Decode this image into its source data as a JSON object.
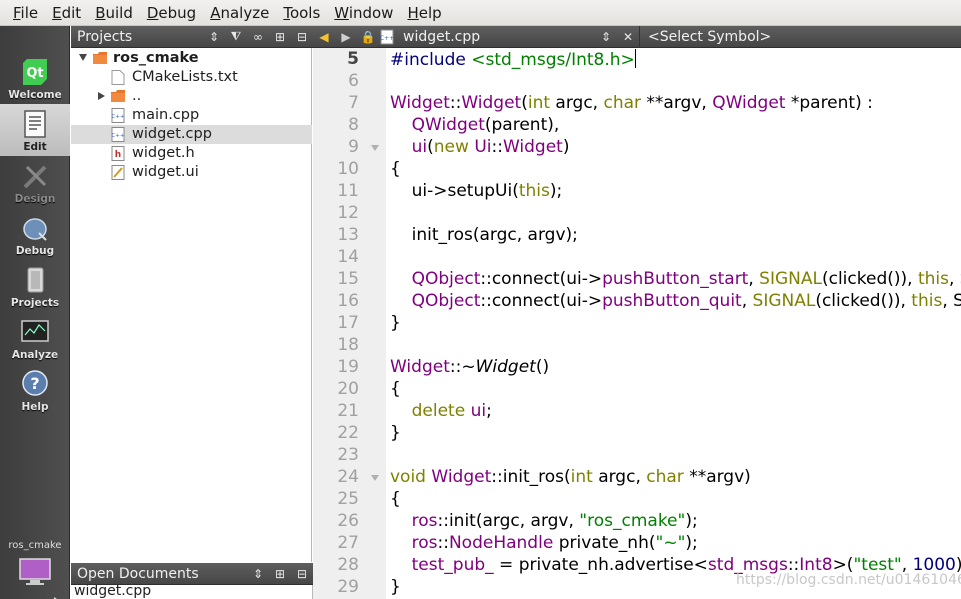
{
  "menu": [
    {
      "u": "F",
      "rest": "ile"
    },
    {
      "u": "E",
      "rest": "dit"
    },
    {
      "u": "B",
      "rest": "uild"
    },
    {
      "u": "D",
      "rest": "ebug"
    },
    {
      "u": "A",
      "rest": "nalyze"
    },
    {
      "u": "T",
      "rest": "ools"
    },
    {
      "u": "W",
      "rest": "indow"
    },
    {
      "u": "H",
      "rest": "elp"
    }
  ],
  "modes": [
    {
      "label": "Welcome",
      "icon": "qt-logo-icon"
    },
    {
      "label": "Edit",
      "icon": "edit-document-icon"
    },
    {
      "label": "Design",
      "icon": "design-pencil-icon"
    },
    {
      "label": "Debug",
      "icon": "debug-bug-icon"
    },
    {
      "label": "Projects",
      "icon": "projects-wrench-icon"
    },
    {
      "label": "Analyze",
      "icon": "analyze-monitor-icon"
    },
    {
      "label": "Help",
      "icon": "help-question-icon"
    }
  ],
  "kit": {
    "label": "ros_cmake",
    "small": "all"
  },
  "projects_panel": {
    "title": "Projects"
  },
  "open_docs_panel": {
    "title": "Open Documents",
    "first_doc": "widget.cpp"
  },
  "editor": {
    "file_tab": "widget.cpp",
    "symbol": "<Select Symbol>"
  },
  "tree": [
    {
      "label": "ros_cmake",
      "type": "project"
    },
    {
      "label": "CMakeLists.txt",
      "type": "file"
    },
    {
      "label": "..",
      "type": "folder"
    },
    {
      "label": "main.cpp",
      "type": "cpp"
    },
    {
      "label": "widget.cpp",
      "type": "cpp",
      "selected": true
    },
    {
      "label": "widget.h",
      "type": "header"
    },
    {
      "label": "widget.ui",
      "type": "ui"
    }
  ],
  "line_numbers": [
    "5",
    "6",
    "7",
    "8",
    "9",
    "10",
    "11",
    "12",
    "13",
    "14",
    "15",
    "16",
    "17",
    "18",
    "19",
    "20",
    "21",
    "22",
    "23",
    "24",
    "25",
    "26",
    "27",
    "28",
    "29"
  ],
  "code_lines": [
    [
      [
        "pre",
        "#include "
      ],
      [
        "inc",
        "<std_msgs/Int8.h>"
      ]
    ],
    [],
    [
      [
        "type",
        "Widget"
      ],
      [
        "",
        "::"
      ],
      [
        "type",
        "Widget"
      ],
      [
        "",
        "("
      ],
      [
        "kw",
        "int"
      ],
      [
        "",
        " argc, "
      ],
      [
        "kw",
        "char"
      ],
      [
        "",
        " **argv, "
      ],
      [
        "type",
        "QWidget"
      ],
      [
        "",
        " *parent) :"
      ]
    ],
    [
      [
        "",
        "    "
      ],
      [
        "type",
        "QWidget"
      ],
      [
        "",
        "(parent),"
      ]
    ],
    [
      [
        "",
        "    "
      ],
      [
        "type",
        "ui"
      ],
      [
        "",
        "("
      ],
      [
        "kw",
        "new"
      ],
      [
        "",
        " "
      ],
      [
        "type",
        "Ui"
      ],
      [
        "",
        "::"
      ],
      [
        "type",
        "Widget"
      ],
      [
        "",
        ")"
      ]
    ],
    [
      [
        "",
        "{"
      ]
    ],
    [
      [
        "",
        "    ui->setupUi("
      ],
      [
        "kw",
        "this"
      ],
      [
        "",
        ");"
      ]
    ],
    [],
    [
      [
        "",
        "    init_ros(argc, argv);"
      ]
    ],
    [],
    [
      [
        "",
        "    "
      ],
      [
        "type",
        "QObject"
      ],
      [
        "",
        "::connect(ui->"
      ],
      [
        "type",
        "pushButton_start"
      ],
      [
        "",
        ", "
      ],
      [
        "kw",
        "SIGNAL"
      ],
      [
        "",
        "(clicked()), "
      ],
      [
        "kw",
        "this"
      ],
      [
        "",
        ", S"
      ]
    ],
    [
      [
        "",
        "    "
      ],
      [
        "type",
        "QObject"
      ],
      [
        "",
        "::connect(ui->"
      ],
      [
        "type",
        "pushButton_quit"
      ],
      [
        "",
        ", "
      ],
      [
        "kw",
        "SIGNAL"
      ],
      [
        "",
        "(clicked()), "
      ],
      [
        "kw",
        "this"
      ],
      [
        "",
        ", S"
      ]
    ],
    [
      [
        "",
        "}"
      ]
    ],
    [],
    [
      [
        "type",
        "Widget"
      ],
      [
        "",
        "::~"
      ],
      [
        "it",
        "Widget"
      ],
      [
        "",
        "()"
      ]
    ],
    [
      [
        "",
        "{"
      ]
    ],
    [
      [
        "",
        "    "
      ],
      [
        "kw",
        "delete"
      ],
      [
        "",
        " "
      ],
      [
        "type",
        "ui"
      ],
      [
        "",
        ";"
      ]
    ],
    [
      [
        "",
        "}"
      ]
    ],
    [],
    [
      [
        "kw",
        "void"
      ],
      [
        "",
        " "
      ],
      [
        "type",
        "Widget"
      ],
      [
        "",
        "::init_ros("
      ],
      [
        "kw",
        "int"
      ],
      [
        "",
        " argc, "
      ],
      [
        "kw",
        "char"
      ],
      [
        "",
        " **argv)"
      ]
    ],
    [
      [
        "",
        "{"
      ]
    ],
    [
      [
        "",
        "    "
      ],
      [
        "type",
        "ros"
      ],
      [
        "",
        "::init(argc, argv, "
      ],
      [
        "str",
        "\"ros_cmake\""
      ],
      [
        "",
        ");"
      ]
    ],
    [
      [
        "",
        "    "
      ],
      [
        "type",
        "ros"
      ],
      [
        "",
        "::"
      ],
      [
        "type",
        "NodeHandle"
      ],
      [
        "",
        " private_nh("
      ],
      [
        "str",
        "\"~\""
      ],
      [
        "",
        ");"
      ]
    ],
    [
      [
        "",
        "    "
      ],
      [
        "type",
        "test_pub_"
      ],
      [
        "",
        " = private_nh.advertise<"
      ],
      [
        "type",
        "std_msgs"
      ],
      [
        "",
        "::"
      ],
      [
        "type",
        "Int8"
      ],
      [
        "",
        ">("
      ],
      [
        "str",
        "\"test\""
      ],
      [
        "",
        ", "
      ],
      [
        "num",
        "1000"
      ],
      [
        "",
        ");"
      ]
    ],
    [
      [
        "",
        "}"
      ]
    ]
  ],
  "watermark": "https://blog.csdn.net/u014610460"
}
